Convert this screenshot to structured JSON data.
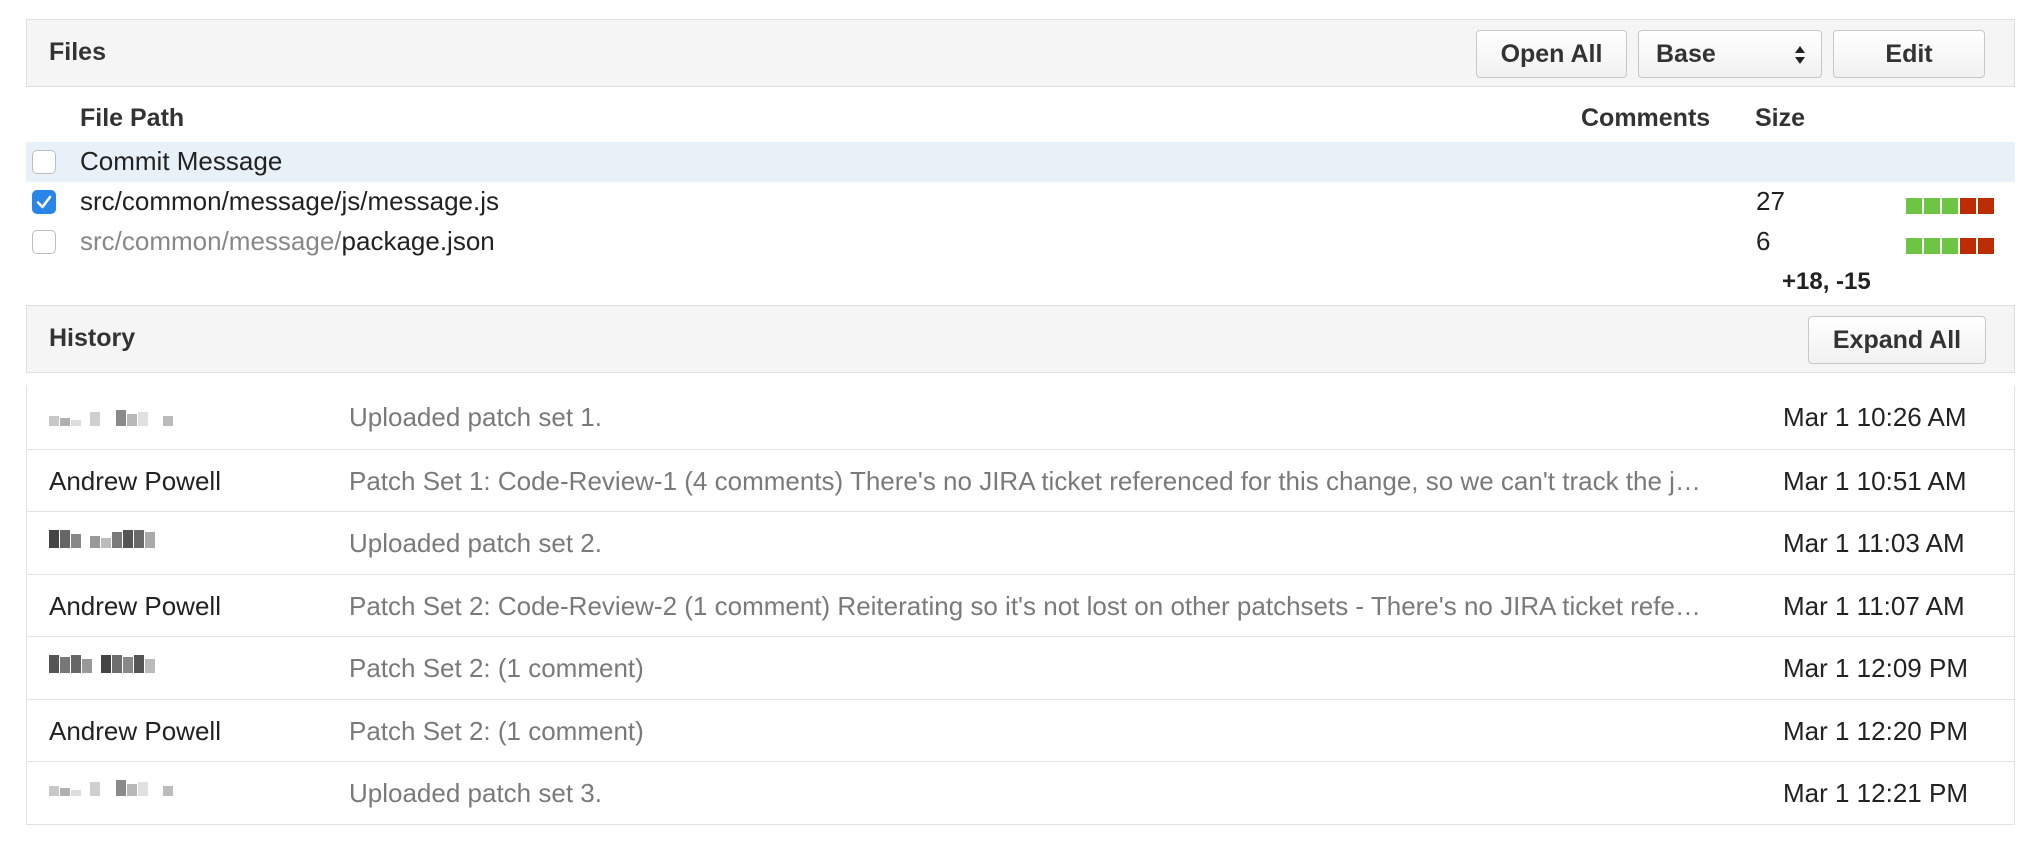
{
  "files": {
    "title": "Files",
    "open_all_label": "Open All",
    "base_select_value": "Base",
    "edit_label": "Edit",
    "columns": {
      "file_path": "File Path",
      "comments": "Comments",
      "size": "Size"
    },
    "rows": [
      {
        "dir": "",
        "name": "Commit Message",
        "size": "",
        "checked": false,
        "highlighted": true
      },
      {
        "dir": "",
        "name": "src/common/message/js/message.js",
        "size": "27",
        "checked": true,
        "highlighted": false
      },
      {
        "dir": "src/common/message/",
        "name": "package.json",
        "size": "6",
        "checked": false,
        "highlighted": false
      }
    ],
    "total_delta": "+18, -15"
  },
  "history": {
    "title": "History",
    "expand_all_label": "Expand All",
    "rows": [
      {
        "author": "",
        "author_redacted": true,
        "message": "Uploaded patch set 1.",
        "date": "Mar 1 10:26 AM"
      },
      {
        "author": "Andrew Powell",
        "message": "Patch Set 1: Code-Review-1 (4 comments) There's no JIRA ticket referenced for this change, so we can't track the j…",
        "date": "Mar 1 10:51 AM"
      },
      {
        "author": "",
        "author_redacted": true,
        "message": "Uploaded patch set 2.",
        "date": "Mar 1 11:03 AM"
      },
      {
        "author": "Andrew Powell",
        "message": "Patch Set 2: Code-Review-2 (1 comment) Reiterating so it's not lost on other patchsets - There's no JIRA ticket refe…",
        "date": "Mar 1 11:07 AM"
      },
      {
        "author": "",
        "author_redacted": true,
        "message": "Patch Set 2: (1 comment)",
        "date": "Mar 1 12:09 PM"
      },
      {
        "author": "Andrew Powell",
        "message": "Patch Set 2: (1 comment)",
        "date": "Mar 1 12:20 PM"
      },
      {
        "author": "",
        "author_redacted": true,
        "message": "Uploaded patch set 3.",
        "date": "Mar 1 12:21 PM"
      }
    ]
  },
  "colors": {
    "accent_blue": "#2a85e8",
    "row_highlight": "#e8f0f8",
    "size_added": "#6cc644",
    "size_removed": "#bd2c00"
  }
}
